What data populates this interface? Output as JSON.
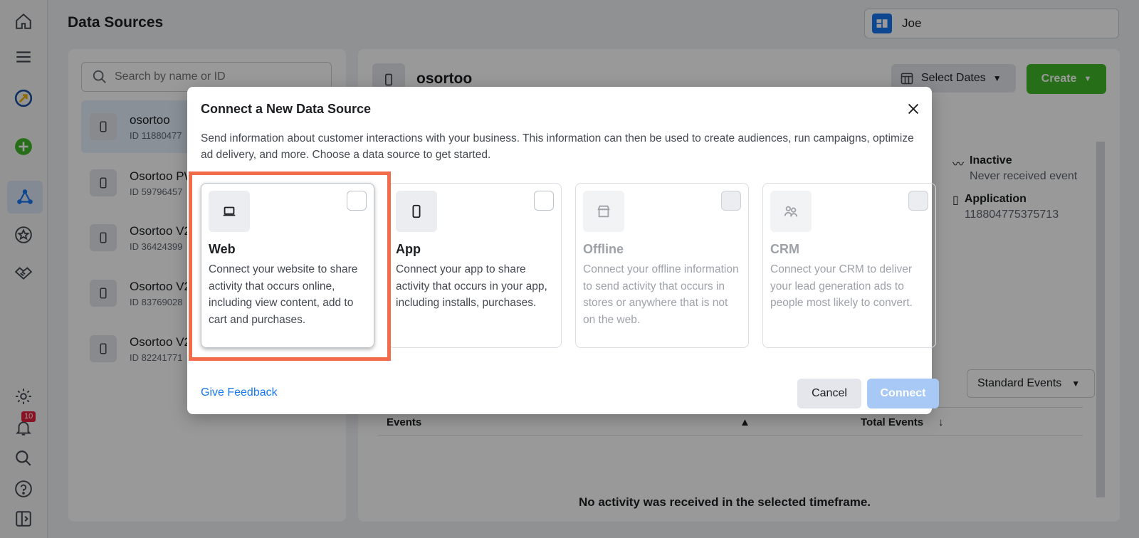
{
  "page": {
    "title": "Data Sources"
  },
  "account": {
    "name": "Joe"
  },
  "rail": {
    "notification_count": "10"
  },
  "search": {
    "placeholder": "Search by name or ID"
  },
  "sources": [
    {
      "name": "osortoo",
      "id": "ID 11880477"
    },
    {
      "name": "Osortoo PW",
      "id": "ID 59796457"
    },
    {
      "name": "Osortoo V2",
      "id": "ID 36424399"
    },
    {
      "name": "Osortoo V2",
      "id": "ID 83769028"
    },
    {
      "name": "Osortoo V2",
      "id": "ID 82241771"
    }
  ],
  "detail": {
    "title": "osortoo",
    "select_dates": "Select Dates",
    "create": "Create",
    "status_label": "Inactive",
    "status_sub": "Never received event",
    "type_label": "Application",
    "type_id": "118804775375713",
    "events_filter": "Standard Events",
    "col_events": "Events",
    "col_total": "Total Events",
    "empty_msg": "No activity was received in the selected timeframe."
  },
  "modal": {
    "title": "Connect a New Data Source",
    "description": "Send information about customer interactions with your business. This information can then be used to create audiences, run campaigns, optimize ad delivery, and more. Choose a data source to get started.",
    "options": [
      {
        "title": "Web",
        "desc": "Connect your website to share activity that occurs online, including view content, add to cart and purchases."
      },
      {
        "title": "App",
        "desc": "Connect your app to share activity that occurs in your app, including installs, purchases."
      },
      {
        "title": "Offline",
        "desc": "Connect your offline information to send activity that occurs in stores or anywhere that is not on the web."
      },
      {
        "title": "CRM",
        "desc": "Connect your CRM to deliver your lead generation ads to people most likely to convert."
      }
    ],
    "feedback": "Give Feedback",
    "cancel": "Cancel",
    "connect": "Connect"
  },
  "colors": {
    "accent": "#1877f2",
    "create": "#42b72a",
    "highlight": "#f26b4a"
  }
}
